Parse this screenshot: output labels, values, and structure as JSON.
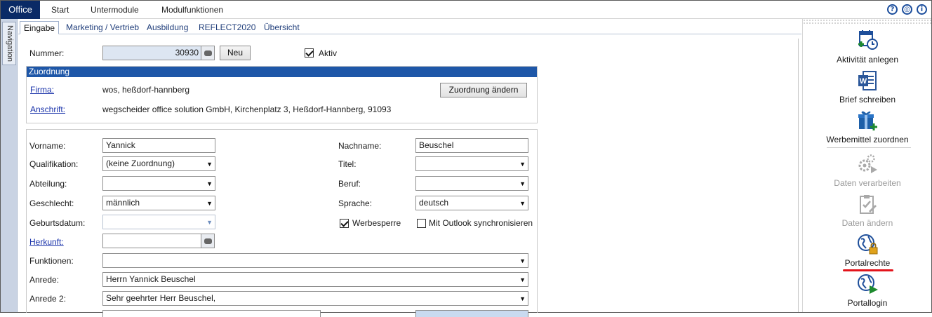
{
  "menubar": {
    "office": "Office",
    "items": [
      "Start",
      "Untermodule",
      "Modulfunktionen"
    ],
    "icons": [
      "help-icon",
      "globe-icon",
      "info-icon"
    ]
  },
  "nav": {
    "label": "Navigation"
  },
  "tabs": [
    "Eingabe",
    "Marketing / Vertrieb",
    "Ausbildung",
    "REFLECT2020",
    "Übersicht"
  ],
  "form": {
    "nummer_label": "Nummer:",
    "nummer_value": "30930",
    "neu_button": "Neu",
    "aktiv_label": "Aktiv",
    "zuordnung": {
      "title": "Zuordnung",
      "firma_label": "Firma:",
      "firma_value": "wos, heßdorf-hannberg",
      "anschrift_label": "Anschrift:",
      "anschrift_value": "wegscheider office solution GmbH, Kirchenplatz 3, Heßdorf-Hannberg, 91093",
      "change_button": "Zuordnung ändern"
    },
    "vorname_label": "Vorname:",
    "vorname_value": "Yannick",
    "nachname_label": "Nachname:",
    "nachname_value": "Beuschel",
    "qualifikation_label": "Qualifikation:",
    "qualifikation_value": "(keine Zuordnung)",
    "titel_label": "Titel:",
    "titel_value": "",
    "abteilung_label": "Abteilung:",
    "abteilung_value": "",
    "beruf_label": "Beruf:",
    "beruf_value": "",
    "geschlecht_label": "Geschlecht:",
    "geschlecht_value": "männlich",
    "sprache_label": "Sprache:",
    "sprache_value": "deutsch",
    "geburtsdatum_label": "Geburtsdatum:",
    "geburtsdatum_value": "",
    "werbesperre_label": "Werbesperre",
    "outlook_label": "Mit Outlook synchronisieren",
    "herkunft_label": "Herkunft:",
    "herkunft_value": "",
    "funktionen_label": "Funktionen:",
    "funktionen_value": "",
    "anrede_label": "Anrede:",
    "anrede_value": "Herrn Yannick Beuschel",
    "anrede2_label": "Anrede 2:",
    "anrede2_value": "Sehr geehrter Herr Beuschel,"
  },
  "actions": [
    {
      "label": "Aktivität anlegen",
      "icon": "calendar-add-icon",
      "enabled": true
    },
    {
      "label": "Brief schreiben",
      "icon": "word-icon",
      "enabled": true
    },
    {
      "label": "Werbemittel zuordnen",
      "icon": "gift-add-icon",
      "enabled": true
    },
    {
      "label": "Daten verarbeiten",
      "icon": "gears-play-icon",
      "enabled": false
    },
    {
      "label": "Daten ändern",
      "icon": "clipboard-edit-icon",
      "enabled": false
    },
    {
      "label": "Portalrechte",
      "icon": "globe-lock-icon",
      "enabled": true
    },
    {
      "label": "Portallogin",
      "icon": "globe-play-icon",
      "enabled": true
    }
  ],
  "colors": {
    "office_bg": "#0a2a66",
    "group_header": "#1e57a8",
    "highlight_underline": "#e3141b"
  }
}
